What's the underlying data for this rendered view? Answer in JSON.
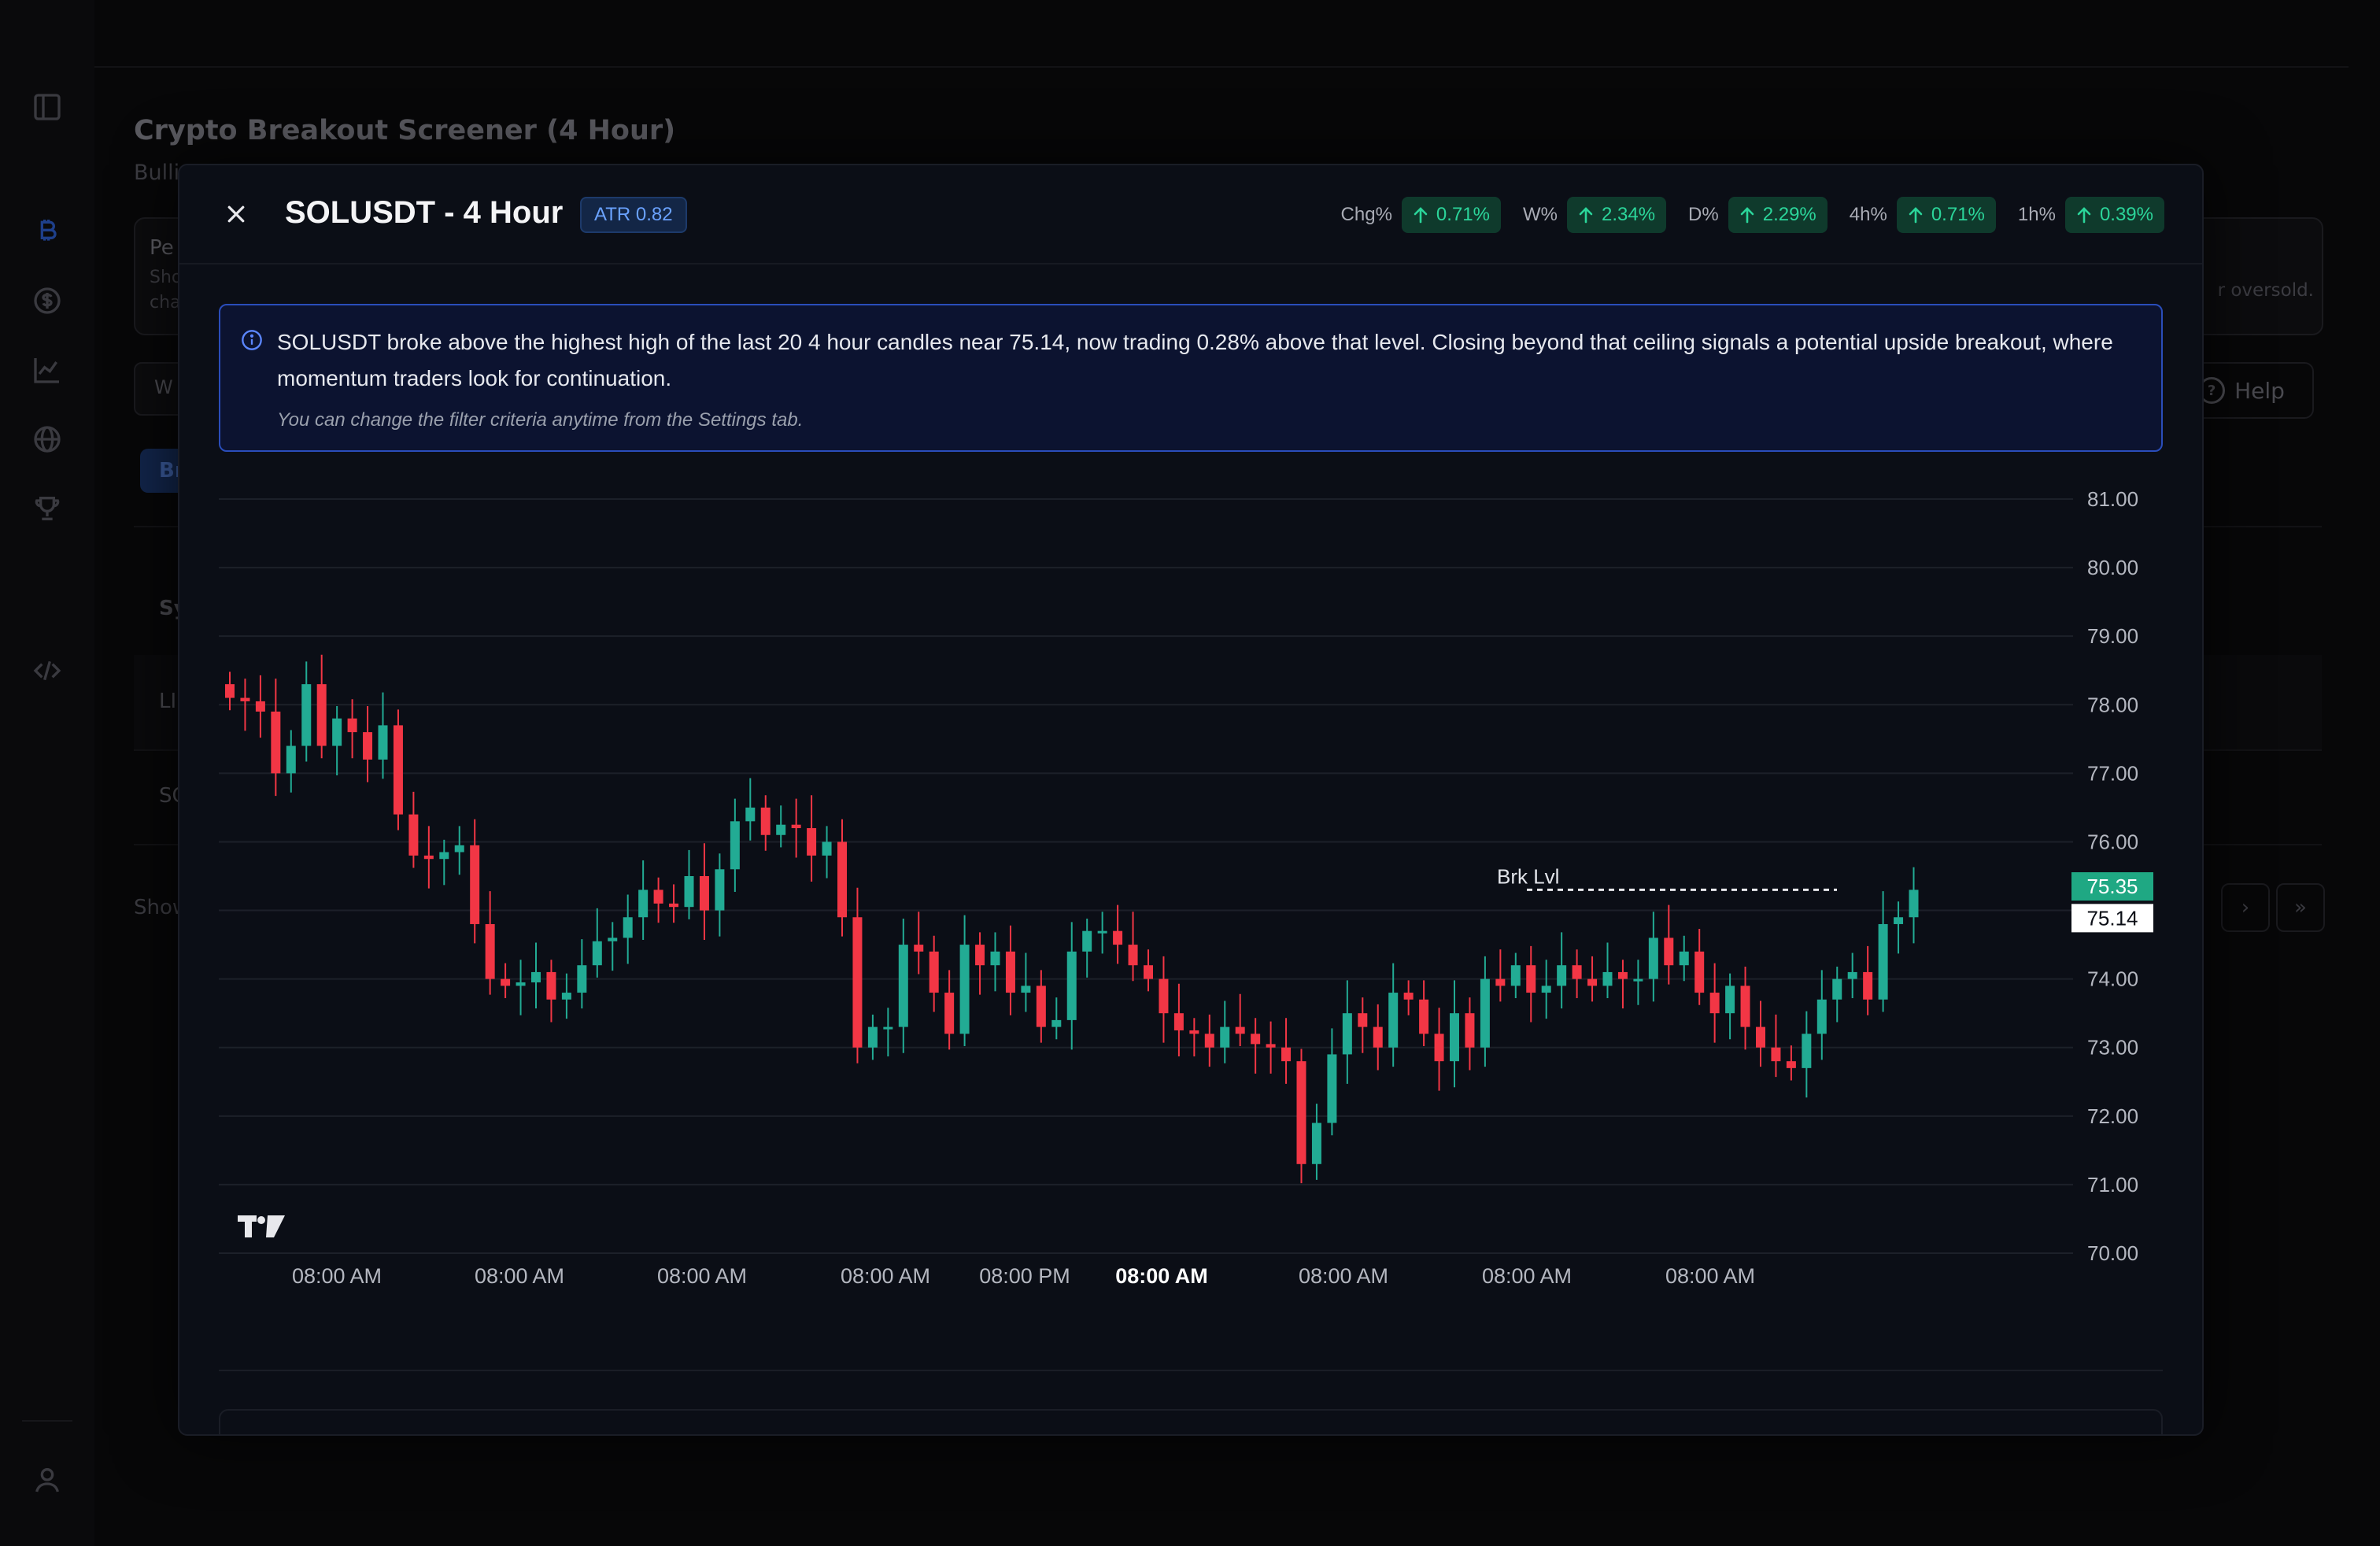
{
  "app": {
    "page_title": "Crypto Breakout Screener (4 Hour)",
    "page_subtitle": "Bulli",
    "card_title": "Pe",
    "card_sub1": "Sho",
    "card_sub2": "cha",
    "card_right": "r oversold.",
    "input_value": "W",
    "help_label": "Help",
    "tab_label": "Br",
    "table_header_partial": "Sy",
    "row1_partial": "LI",
    "row2_partial": "SO",
    "footer_partial": "Show",
    "next_page": "›",
    "last_page": "»"
  },
  "modal": {
    "title": "SOLUSDT - 4 Hour",
    "atr_badge": "ATR 0.82",
    "close_label": "close",
    "stats": [
      {
        "label": "Chg%",
        "value": "0.71%"
      },
      {
        "label": "W%",
        "value": "2.34%"
      },
      {
        "label": "D%",
        "value": "2.29%"
      },
      {
        "label": "4h%",
        "value": "0.71%"
      },
      {
        "label": "1h%",
        "value": "0.39%"
      }
    ],
    "info_text": "SOLUSDT broke above the highest high of the last 20 4 hour candles near 75.14, now trading 0.28% above that level. Closing beyond that ceiling signals a potential upside breakout, where momentum traders look for continuation.",
    "info_note": "You can change the filter criteria anytime from the Settings tab."
  },
  "colors": {
    "up": "#22ab94",
    "down": "#f23645",
    "accent": "#2a4dba",
    "stat_green": "#2bd59a"
  },
  "chart_data": {
    "type": "candlestick",
    "y_ticks": [
      "81.00",
      "80.00",
      "79.00",
      "78.00",
      "77.00",
      "76.00",
      "74.00",
      "73.00",
      "72.00",
      "71.00",
      "70.00"
    ],
    "ylim": [
      69.7,
      81.3
    ],
    "x_labels": [
      {
        "label": "08:00 AM",
        "bold": false
      },
      {
        "label": "08:00 AM",
        "bold": false
      },
      {
        "label": "08:00 AM",
        "bold": false
      },
      {
        "label": "08:00 AM",
        "bold": false
      },
      {
        "label": "08:00 PM",
        "bold": false
      },
      {
        "label": "08:00 AM",
        "bold": true
      },
      {
        "label": "08:00 AM",
        "bold": false
      },
      {
        "label": "08:00 AM",
        "bold": false
      },
      {
        "label": "08:00 AM",
        "bold": false
      }
    ],
    "breakout_level": 75.14,
    "breakout_label": "Brk Lvl",
    "breakout_tag": "75.14",
    "last_price": 75.35,
    "last_price_tag": "75.35",
    "closes": [
      78.1,
      78.05,
      77.9,
      77.0,
      77.4,
      78.3,
      77.4,
      77.8,
      77.6,
      77.2,
      77.7,
      76.4,
      75.8,
      75.75,
      75.85,
      75.95,
      74.8,
      74.0,
      73.9,
      73.95,
      74.1,
      73.7,
      73.8,
      74.2,
      74.55,
      74.6,
      74.9,
      75.3,
      75.1,
      75.05,
      75.5,
      75.0,
      75.6,
      76.3,
      76.5,
      76.1,
      76.25,
      76.2,
      75.8,
      76.0,
      74.9,
      73.0,
      73.3,
      73.3,
      74.5,
      74.4,
      73.8,
      73.2,
      74.5,
      74.2,
      74.4,
      73.8,
      73.9,
      73.3,
      73.4,
      74.4,
      74.7,
      74.7,
      74.5,
      74.2,
      74.0,
      73.5,
      73.25,
      73.2,
      73.0,
      73.3,
      73.2,
      73.05,
      73.0,
      72.8,
      71.3,
      71.9,
      72.9,
      73.5,
      73.3,
      73.0,
      73.8,
      73.7,
      73.2,
      72.8,
      73.5,
      73.0,
      74.0,
      73.9,
      74.2,
      73.8,
      73.9,
      74.2,
      74.0,
      73.9,
      74.1,
      74.0,
      74.0,
      74.6,
      74.2,
      74.4,
      73.8,
      73.5,
      73.9,
      73.3,
      73.0,
      72.8,
      72.7,
      73.2,
      73.7,
      74.0,
      74.1,
      73.7,
      74.8,
      74.9,
      75.3
    ]
  }
}
